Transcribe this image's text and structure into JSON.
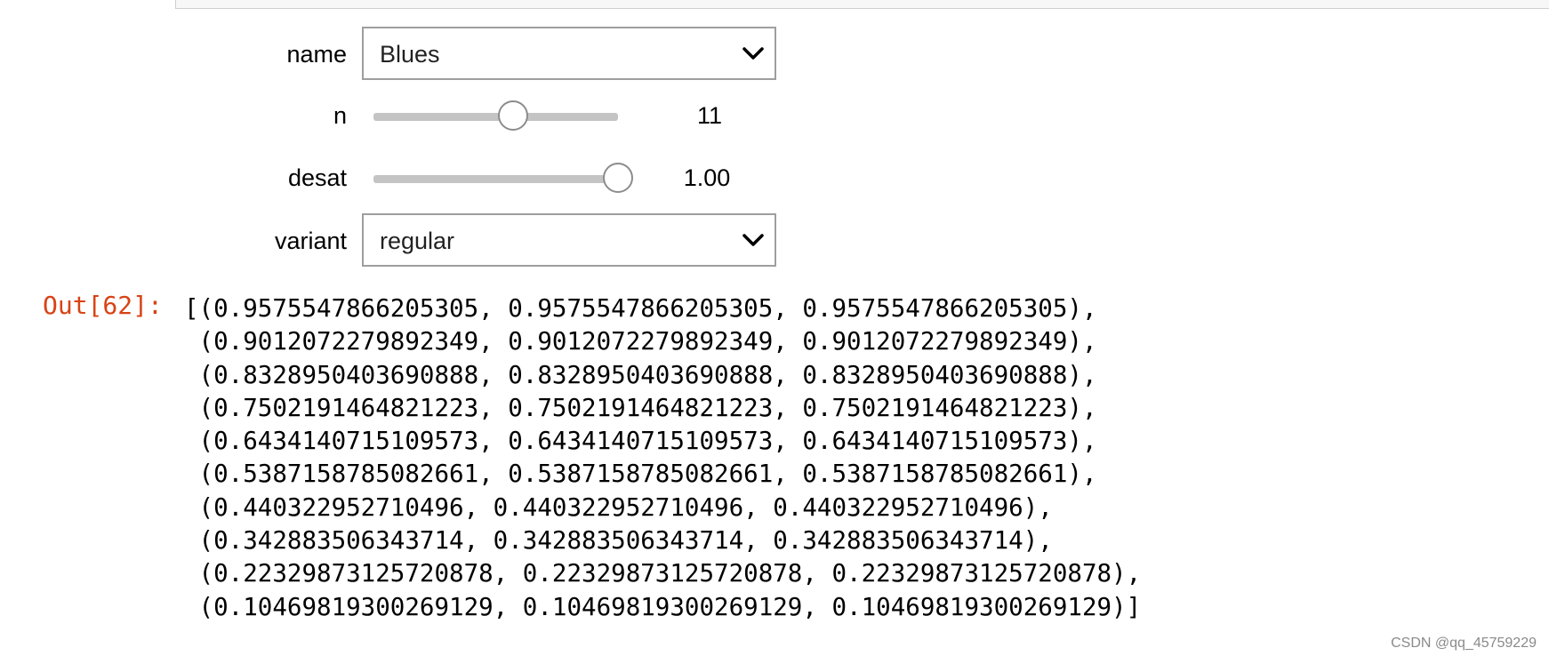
{
  "widgets": {
    "name": {
      "label": "name",
      "value": "Blues"
    },
    "n": {
      "label": "n",
      "value": 11,
      "readout": "11",
      "fraction": 0.57
    },
    "desat": {
      "label": "desat",
      "value": 1.0,
      "readout": "1.00",
      "fraction": 1.0
    },
    "variant": {
      "label": "variant",
      "value": "regular"
    }
  },
  "output": {
    "prompt": "Out[62]:",
    "lines": [
      "[(0.9575547866205305, 0.9575547866205305, 0.9575547866205305),",
      " (0.9012072279892349, 0.9012072279892349, 0.9012072279892349),",
      " (0.8328950403690888, 0.8328950403690888, 0.8328950403690888),",
      " (0.7502191464821223, 0.7502191464821223, 0.7502191464821223),",
      " (0.6434140715109573, 0.6434140715109573, 0.6434140715109573),",
      " (0.5387158785082661, 0.5387158785082661, 0.5387158785082661),",
      " (0.440322952710496, 0.440322952710496, 0.440322952710496),",
      " (0.342883506343714, 0.342883506343714, 0.342883506343714),",
      " (0.22329873125720878, 0.22329873125720878, 0.22329873125720878),",
      " (0.10469819300269129, 0.10469819300269129, 0.10469819300269129)]"
    ]
  },
  "watermark": "CSDN @qq_45759229",
  "colors": {
    "prompt": "#d84315",
    "border": "#9e9e9e",
    "track": "#c4c4c4"
  },
  "icons": {
    "dropdown": "chevron-down-icon"
  }
}
